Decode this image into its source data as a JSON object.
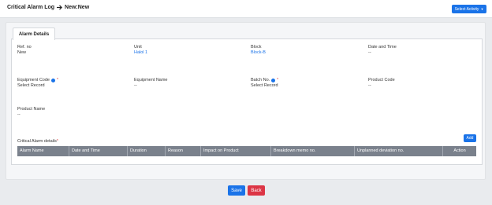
{
  "header": {
    "title": "Critical Alarm Log",
    "subtitle": "New:New",
    "select_activity": "Select Activity"
  },
  "tab": {
    "label": "Alarm Details"
  },
  "fields": {
    "ref_no": {
      "label": "Ref. no",
      "value": "New"
    },
    "unit": {
      "label": "Unit",
      "value": "Halol 1"
    },
    "block": {
      "label": "Block",
      "value": "Block-B"
    },
    "date_time": {
      "label": "Date and Time",
      "value": "--"
    },
    "equipment_code": {
      "label": "Equipment Code",
      "value": "Select Record"
    },
    "equipment_name": {
      "label": "Equipment Name",
      "value": "--"
    },
    "batch_no": {
      "label": "Batch No.",
      "value": "Select Record"
    },
    "product_code": {
      "label": "Product Code",
      "value": "--"
    },
    "product_name": {
      "label": "Product Name",
      "value": "--"
    }
  },
  "alarm_section": {
    "label": "Critical Alarm details",
    "required_mark": "*",
    "add_label": "Add",
    "columns": [
      "Alarm Name",
      "Date and Time",
      "Duration",
      "Reason",
      "Impact on Product",
      "Breakdown memo no.",
      "Unplanned deviation no.",
      "Action"
    ]
  },
  "footer": {
    "save_label": "Save",
    "back_label": "Back"
  },
  "colors": {
    "primary": "#1a73e8",
    "danger": "#dc3545",
    "table_header": "#7a818c"
  }
}
